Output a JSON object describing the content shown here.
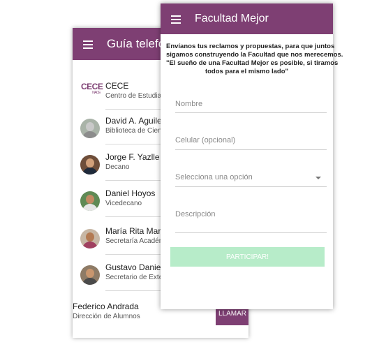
{
  "directory": {
    "title": "Guía telefónic",
    "contacts": [
      {
        "name": "CECE",
        "subtitle": "Centro de Estudiant",
        "logo_text": "CECE",
        "logo_small": "NACE"
      },
      {
        "name": "David A. Aguilera",
        "subtitle": "Biblioteca de Cienc"
      },
      {
        "name": "Jorge F. Yazlle",
        "subtitle": "Decano"
      },
      {
        "name": "Daniel Hoyos",
        "subtitle": "Vicedecano"
      },
      {
        "name": "María Rita Marte",
        "subtitle": "Secretaría Académ"
      },
      {
        "name": "Gustavo Daniel G",
        "subtitle": "Secretario de Exter"
      }
    ],
    "last_contact": {
      "name": "Federico Andrada",
      "subtitle": "Dirección de Alumnos"
    },
    "call_label": "LLAMAR"
  },
  "form": {
    "title": "Facultad Mejor",
    "intro": [
      "Envíanos tus reclamos y propuestas, para que juntos",
      "sigamos construyendo la Facultad que nos merecemos.",
      "\"El sueño de una Facultad Mejor es posible, si tiramos",
      "todos para el mismo lado\""
    ],
    "name_placeholder": "Nombre",
    "phone_placeholder": "Celular (opcional)",
    "select_placeholder": "Selecciona una opción",
    "description_placeholder": "Descripción",
    "submit_label": "PARTICIPAR!"
  },
  "colors": {
    "appbar": "#7e3f73",
    "submit_disabled": "#b7ecc9"
  }
}
